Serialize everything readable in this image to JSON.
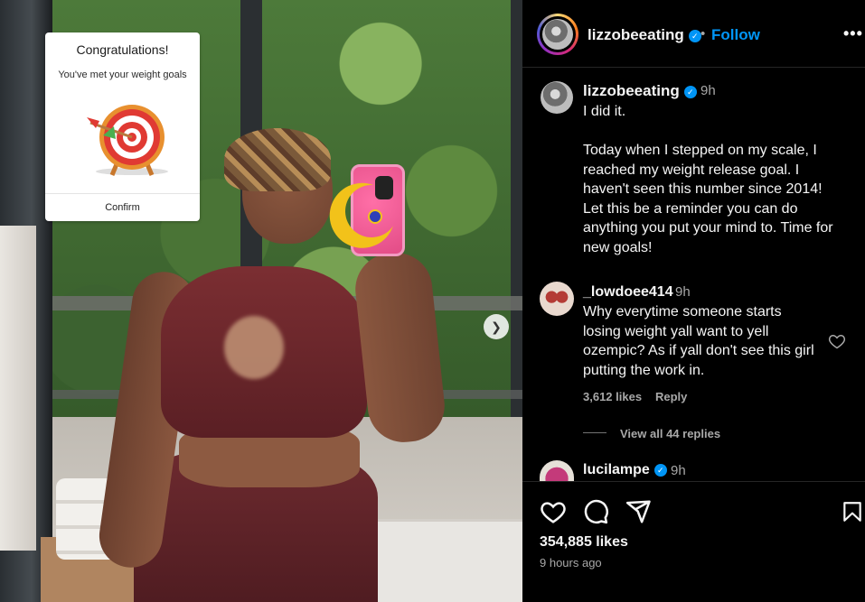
{
  "media": {
    "card": {
      "title": "Congratulations!",
      "subtitle": "You've met your weight goals",
      "confirm_label": "Confirm"
    },
    "next_icon": "chevron-right-icon"
  },
  "header": {
    "username": "lizzobeeating",
    "verified_icon": "verified-badge-icon",
    "separator": "•",
    "follow_label": "Follow",
    "more_icon": "more-options-icon",
    "more_glyph": "•••"
  },
  "caption": {
    "username": "lizzobeeating",
    "time": "9h",
    "text": "I did it.\n\nToday when I stepped on my scale, I reached my weight release goal. I haven't seen this number since 2014! Let this be a reminder you can do anything you put your mind to. Time for new goals!"
  },
  "comments": [
    {
      "username": "_lowdoee414",
      "time": "9h",
      "text": "Why everytime someone starts losing weight yall want to yell ozempic? As if yall don't see this girl putting the work in.",
      "likes": "3,612 likes",
      "reply_label": "Reply",
      "view_replies": "View all 44 replies"
    },
    {
      "username": "lucilampe",
      "time": "9h"
    }
  ],
  "actions": {
    "like_icon": "heart-icon",
    "comment_icon": "comment-icon",
    "share_icon": "share-icon",
    "save_icon": "bookmark-icon",
    "likes": "354,885 likes",
    "posted_ago": "9 hours ago"
  },
  "colors": {
    "accent": "#0095f6",
    "background": "#000000",
    "muted_text": "#a8a8a8"
  }
}
